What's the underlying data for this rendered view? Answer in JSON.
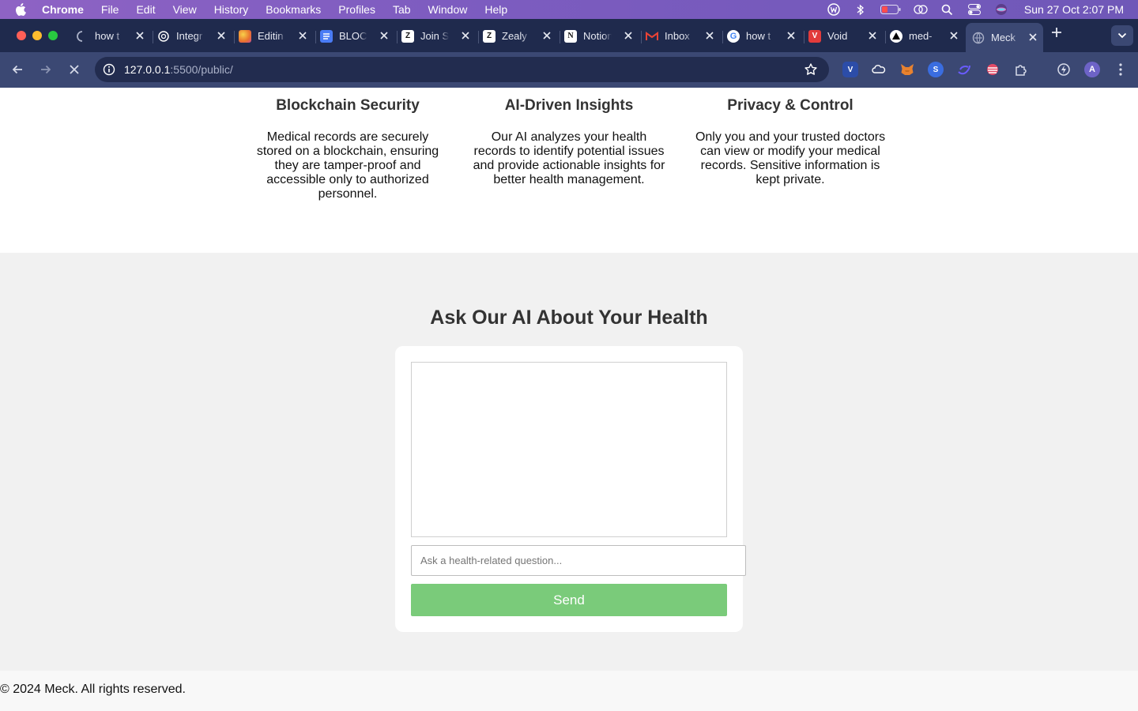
{
  "menubar": {
    "app": "Chrome",
    "items": [
      "File",
      "Edit",
      "View",
      "History",
      "Bookmarks",
      "Profiles",
      "Tab",
      "Window",
      "Help"
    ],
    "clock": "Sun 27 Oct  2:07 PM"
  },
  "tabs": [
    {
      "title": "how t",
      "favicon": "loading-icon",
      "color": "#1f2a4d"
    },
    {
      "title": "Integr",
      "favicon": "openai-icon",
      "color": "#ffffff"
    },
    {
      "title": "Editin",
      "favicon": "firebase-icon",
      "color": "#f5a623"
    },
    {
      "title": "BLOC",
      "favicon": "google-docs-icon",
      "color": "#4a7cf5"
    },
    {
      "title": "Join S",
      "favicon": "zealy-icon",
      "color": "#ffffff"
    },
    {
      "title": "Zealy",
      "favicon": "zealy-icon",
      "color": "#ffffff"
    },
    {
      "title": "Notion",
      "favicon": "notion-icon",
      "color": "#ffffff"
    },
    {
      "title": "Inbox",
      "favicon": "gmail-icon",
      "color": "#ea4335"
    },
    {
      "title": "how t",
      "favicon": "google-icon",
      "color": "#ffffff"
    },
    {
      "title": "Void",
      "favicon": "void-icon",
      "color": "#e23b3b"
    },
    {
      "title": "med-",
      "favicon": "vercel-icon",
      "color": "#000000"
    },
    {
      "title": "Meck",
      "favicon": "globe-icon",
      "color": "#3b4873",
      "active": true
    }
  ],
  "address_bar": {
    "host": "127.0.0.1",
    "rest": ":5500/public/"
  },
  "features": [
    {
      "title": "Blockchain Security",
      "text": "Medical records are securely stored on a blockchain, ensuring they are tamper-proof and accessible only to authorized personnel."
    },
    {
      "title": "AI-Driven Insights",
      "text": "Our AI analyzes your health records to identify potential issues and provide actionable insights for better health management."
    },
    {
      "title": "Privacy & Control",
      "text": "Only you and your trusted doctors can view or modify your medical records. Sensitive information is kept private."
    }
  ],
  "ask": {
    "title": "Ask Our AI About Your Health",
    "placeholder": "Ask a health-related question...",
    "send_label": "Send"
  },
  "footer": {
    "text": "© 2024 Meck. All rights reserved."
  },
  "colors": {
    "menubar": "#7d5cc0",
    "tabstrip": "#1f2a4d",
    "toolbar": "#3b4873",
    "send_button": "#7acb7a",
    "section_bg": "#f1f1f1"
  }
}
